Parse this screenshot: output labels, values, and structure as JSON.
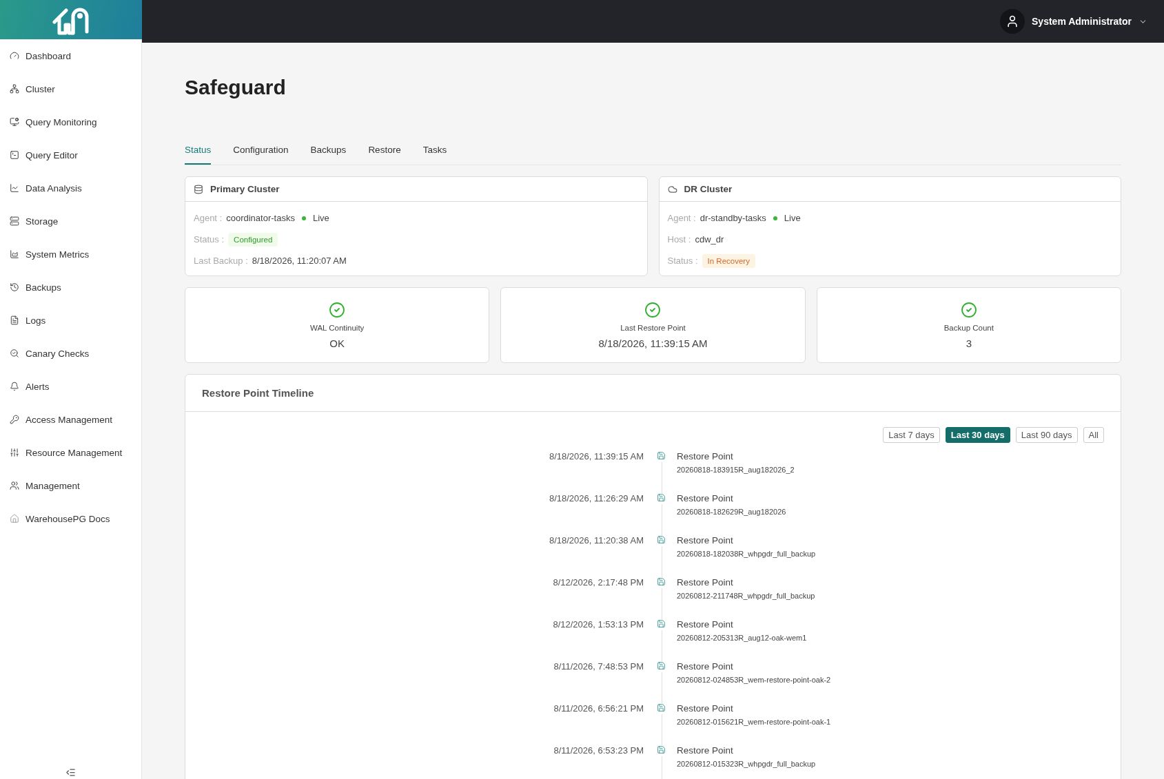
{
  "header": {
    "user": "System Administrator"
  },
  "sidebar": {
    "items": [
      {
        "label": "Dashboard"
      },
      {
        "label": "Cluster"
      },
      {
        "label": "Query Monitoring"
      },
      {
        "label": "Query Editor"
      },
      {
        "label": "Data Analysis"
      },
      {
        "label": "Storage"
      },
      {
        "label": "System Metrics"
      },
      {
        "label": "Backups"
      },
      {
        "label": "Logs"
      },
      {
        "label": "Canary Checks"
      },
      {
        "label": "Alerts"
      },
      {
        "label": "Access Management"
      },
      {
        "label": "Resource Management"
      },
      {
        "label": "Management"
      },
      {
        "label": "WarehousePG Docs"
      }
    ]
  },
  "page": {
    "title": "Safeguard"
  },
  "tabs": [
    {
      "label": "Status",
      "selected": true
    },
    {
      "label": "Configuration",
      "selected": false
    },
    {
      "label": "Backups",
      "selected": false
    },
    {
      "label": "Restore",
      "selected": false
    },
    {
      "label": "Tasks",
      "selected": false
    }
  ],
  "clusters": [
    {
      "title": "Primary Cluster",
      "fields": [
        {
          "label": "Agent :",
          "kind": "agent",
          "value": "coordinator-tasks",
          "live": true,
          "live_label": "Live"
        },
        {
          "label": "Status :",
          "kind": "badge_success",
          "value": "Configured"
        },
        {
          "label": "Last Backup :",
          "kind": "text",
          "value": "8/18/2026, 11:20:07 AM"
        }
      ]
    },
    {
      "title": "DR Cluster",
      "fields": [
        {
          "label": "Agent :",
          "kind": "agent",
          "value": "dr-standby-tasks",
          "live": true,
          "live_label": "Live"
        },
        {
          "label": "Host :",
          "kind": "text",
          "value": "cdw_dr"
        },
        {
          "label": "Status :",
          "kind": "badge_warning",
          "value": "In Recovery"
        }
      ]
    }
  ],
  "stats": [
    {
      "label": "WAL Continuity",
      "value": "OK",
      "ok": true
    },
    {
      "label": "Last Restore Point",
      "value": "8/18/2026, 11:39:15 AM",
      "ok": true
    },
    {
      "label": "Backup Count",
      "value": "3",
      "ok": true
    }
  ],
  "timeline": {
    "title": "Restore Point Timeline",
    "ranges": [
      {
        "label": "Last 7 days",
        "selected": false
      },
      {
        "label": "Last 30 days",
        "selected": true
      },
      {
        "label": "Last 90 days",
        "selected": false
      },
      {
        "label": "All",
        "selected": false
      }
    ],
    "items": [
      {
        "time": "8/18/2026, 11:39:15 AM",
        "title": "Restore Point",
        "name": "20260818-183915R_aug182026_2"
      },
      {
        "time": "8/18/2026, 11:26:29 AM",
        "title": "Restore Point",
        "name": "20260818-182629R_aug182026"
      },
      {
        "time": "8/18/2026, 11:20:38 AM",
        "title": "Restore Point",
        "name": "20260818-182038R_whpgdr_full_backup"
      },
      {
        "time": "8/12/2026, 2:17:48 PM",
        "title": "Restore Point",
        "name": "20260812-211748R_whpgdr_full_backup"
      },
      {
        "time": "8/12/2026, 1:53:13 PM",
        "title": "Restore Point",
        "name": "20260812-205313R_aug12-oak-wem1"
      },
      {
        "time": "8/11/2026, 7:48:53 PM",
        "title": "Restore Point",
        "name": "20260812-024853R_wem-restore-point-oak-2"
      },
      {
        "time": "8/11/2026, 6:56:21 PM",
        "title": "Restore Point",
        "name": "20260812-015621R_wem-restore-point-oak-1"
      },
      {
        "time": "8/11/2026, 6:53:23 PM",
        "title": "Restore Point",
        "name": "20260812-015323R_whpgdr_full_backup"
      }
    ]
  }
}
